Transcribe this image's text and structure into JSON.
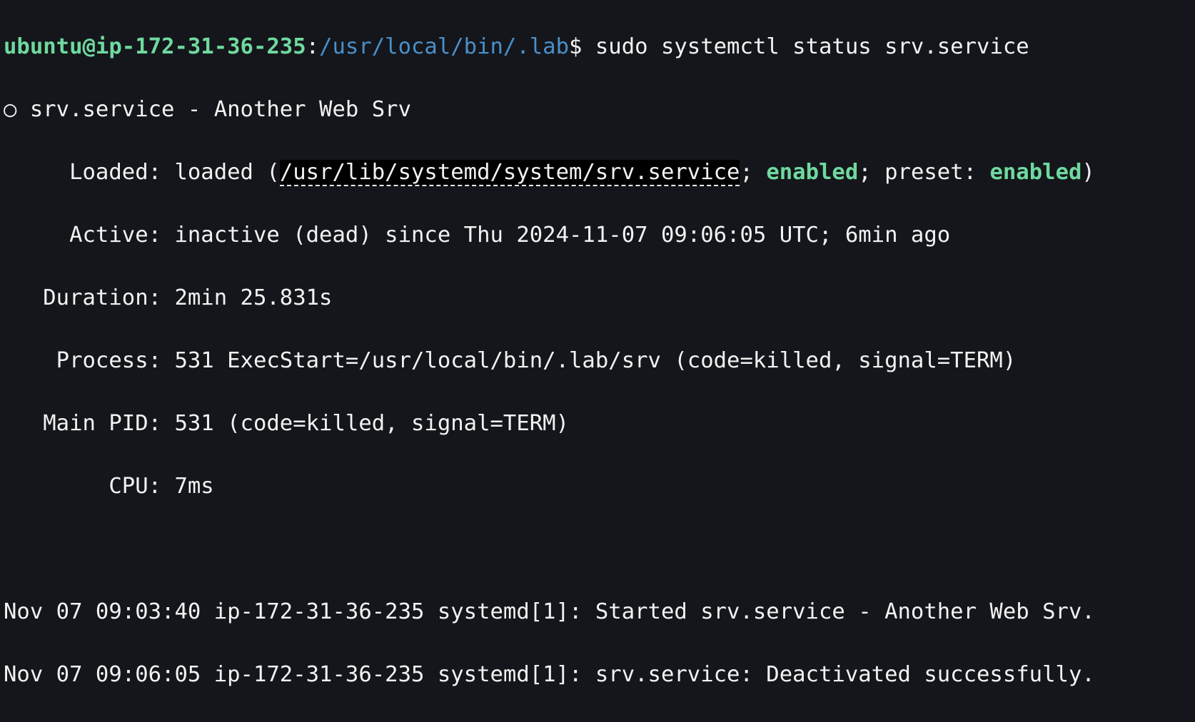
{
  "prompt": {
    "user_host": "ubuntu@ip-172-31-36-235",
    "sep": ":",
    "cwd": "/usr/local/bin/.lab",
    "symbol": "$",
    "command": " sudo systemctl status srv.service"
  },
  "status": {
    "bullet": "○",
    "title": " srv.service - Another Web Srv",
    "loaded_label": "     Loaded: ",
    "loaded_pre": "loaded (",
    "unit_path": "/usr/lib/systemd/system/srv.service",
    "loaded_sep1": "; ",
    "enabled": "enabled",
    "loaded_sep2": "; preset: ",
    "preset": "enabled",
    "loaded_post": ")",
    "active": "     Active: inactive (dead) since Thu 2024-11-07 09:06:05 UTC; 6min ago",
    "duration": "   Duration: 2min 25.831s",
    "process": "    Process: 531 ExecStart=/usr/local/bin/.lab/srv (code=killed, signal=TERM)",
    "main_pid": "   Main PID: 531 (code=killed, signal=TERM)",
    "cpu": "        CPU: 7ms"
  },
  "logs": [
    "Nov 07 09:03:40 ip-172-31-36-235 systemd[1]: Started srv.service - Another Web Srv.",
    "Nov 07 09:06:05 ip-172-31-36-235 systemd[1]: srv.service: Deactivated successfully."
  ]
}
